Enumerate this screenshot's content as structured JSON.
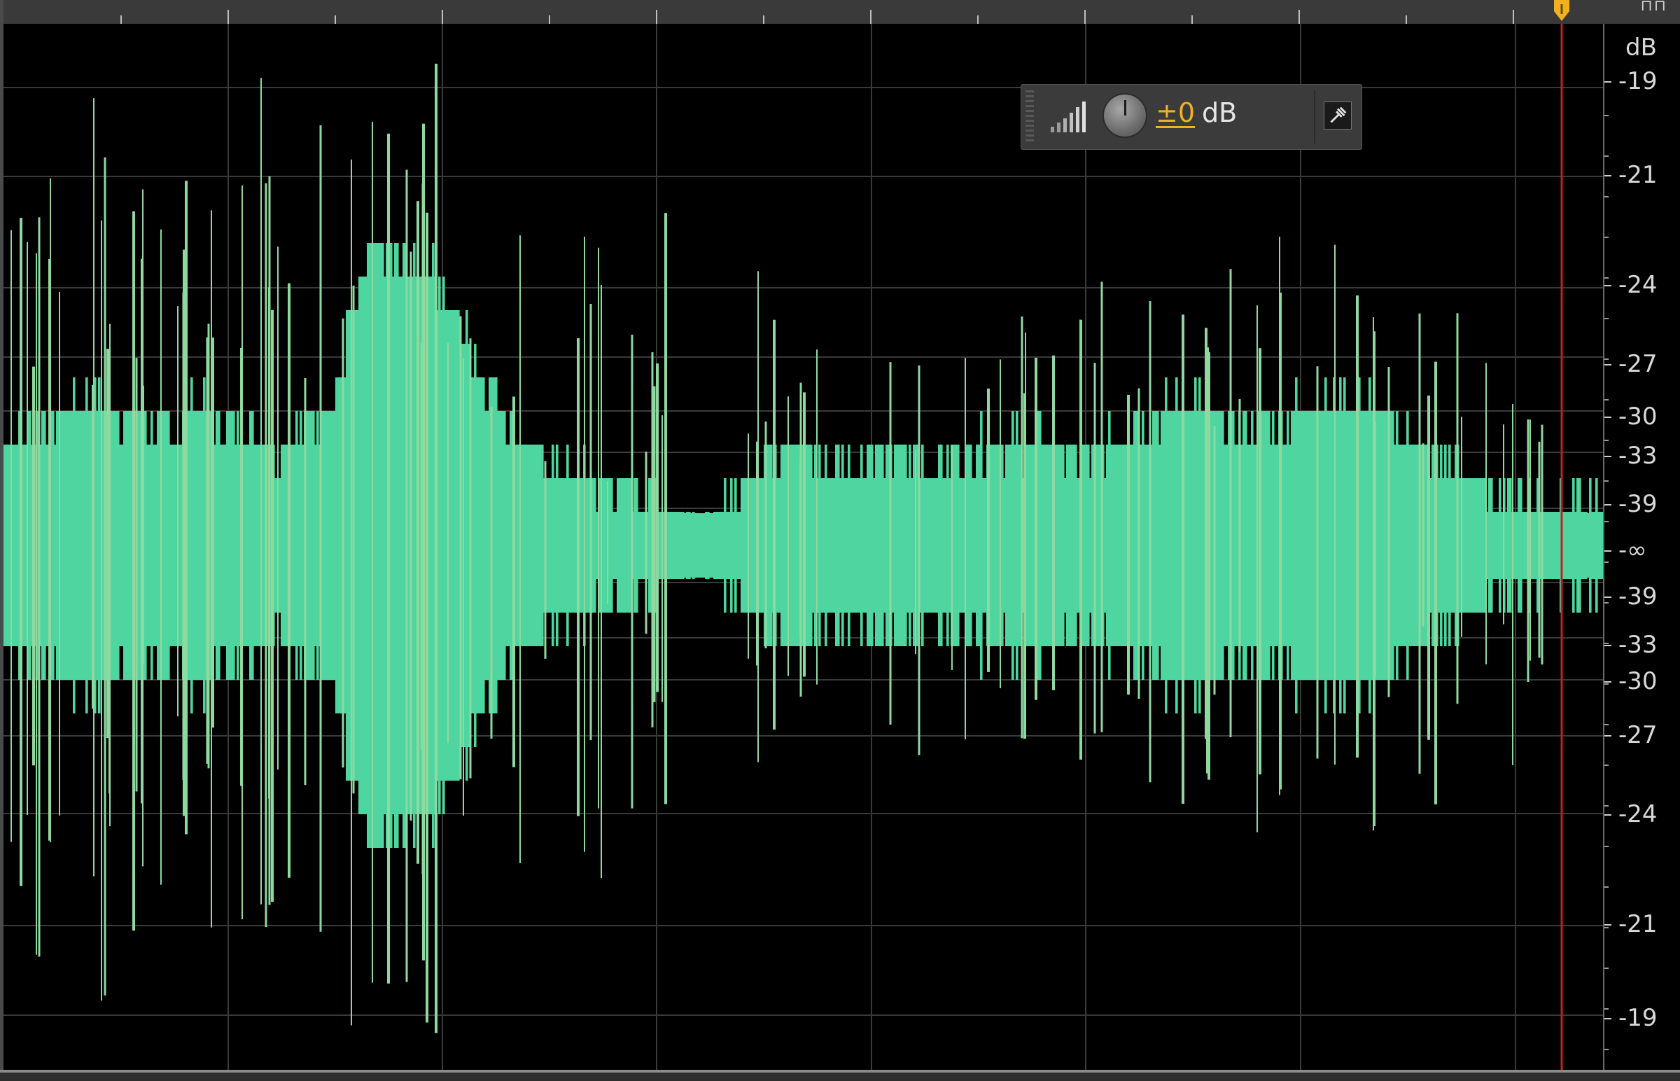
{
  "colors": {
    "waveform": "#4fd6a0",
    "waveform_spike": "#8fd8a0",
    "background": "#000000",
    "grid": "#3a3a3a",
    "playhead": "#c0202a",
    "playhead_marker": "#f0b020",
    "hud_value": "#f0b020"
  },
  "hud": {
    "meter_icon": "signal-bars-icon",
    "knob": "gain-knob",
    "value": "±0",
    "unit": "dB",
    "pin_icon": "pin-icon"
  },
  "db_scale": {
    "unit": "dB",
    "labels": [
      "-19",
      "-21",
      "-24",
      "-27",
      "-30",
      "-33",
      "-39",
      "-∞",
      "-39",
      "-33",
      "-30",
      "-27",
      "-24",
      "-21",
      "-19"
    ]
  },
  "playhead": {
    "marker_icon": "playhead-marker-icon"
  }
}
